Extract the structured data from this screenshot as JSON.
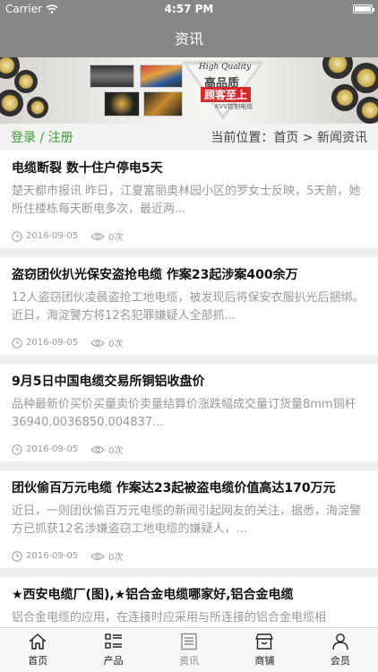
{
  "status_bar": {
    "carrier": "Carrier",
    "time": "4:57 PM"
  },
  "nav": {
    "title": "资讯"
  },
  "banner": {
    "tagline": "High Quality",
    "title_line1": "高品质",
    "title_line2": "顾客至上",
    "subtitle": "KVV控制电缆"
  },
  "crumb": {
    "login": "登录 / 注册",
    "location": "当前位置：首页 > 新闻资讯"
  },
  "articles": [
    {
      "title": "电缆断裂 数十住户停电5天",
      "desc": "楚天都市报讯 昨日，江夏富丽奥林园小区的罗女士反映，5天前，她所住楼栋每天断电多次，最近两...",
      "date": "2016-09-05",
      "views": "0次"
    },
    {
      "title": "盗窃团伙扒光保安盗抢电缆 作案23起涉案400余万",
      "desc": "12人盗窃团伙凌晨盗抢工地电缆，被发现后将保安衣服扒光后捆绑。近日，海淀警方将12名犯罪嫌疑人全部抓...",
      "date": "2016-09-05",
      "views": "0次"
    },
    {
      "title": "9月5日中国电缆交易所铜铝收盘价",
      "desc": "品种最新价买价买量卖价卖量结算价涨跌幅成交量订货量8mm铜杆36940.0036850.004837...",
      "date": "2016-09-05",
      "views": "0次"
    },
    {
      "title": "团伙偷百万元电缆 作案达23起被盗电缆价值高达170万元",
      "desc": "近日，一则团伙偷百万元电缆的新闻引起网友的关注，据悉，海淀警方已抓获12名涉嫌盗窃工地电缆的嫌疑人，...",
      "date": "2016-09-05",
      "views": "0次"
    },
    {
      "title": "★西安电缆厂(图),★铝合金电缆哪家好,铝合金电缆",
      "desc": "铝合金电缆的应用，在连接时应采用与所连接的铝合金电缆相",
      "date": "",
      "views": ""
    }
  ],
  "tabs": [
    {
      "label": "首页",
      "icon": "home-icon"
    },
    {
      "label": "产品",
      "icon": "list-icon"
    },
    {
      "label": "资讯",
      "icon": "news-icon"
    },
    {
      "label": "商铺",
      "icon": "store-icon"
    },
    {
      "label": "会员",
      "icon": "user-icon"
    }
  ],
  "colors": {
    "nav": "#878787",
    "accent_green": "#3a9b32",
    "banner_red": "#d52a2a"
  }
}
